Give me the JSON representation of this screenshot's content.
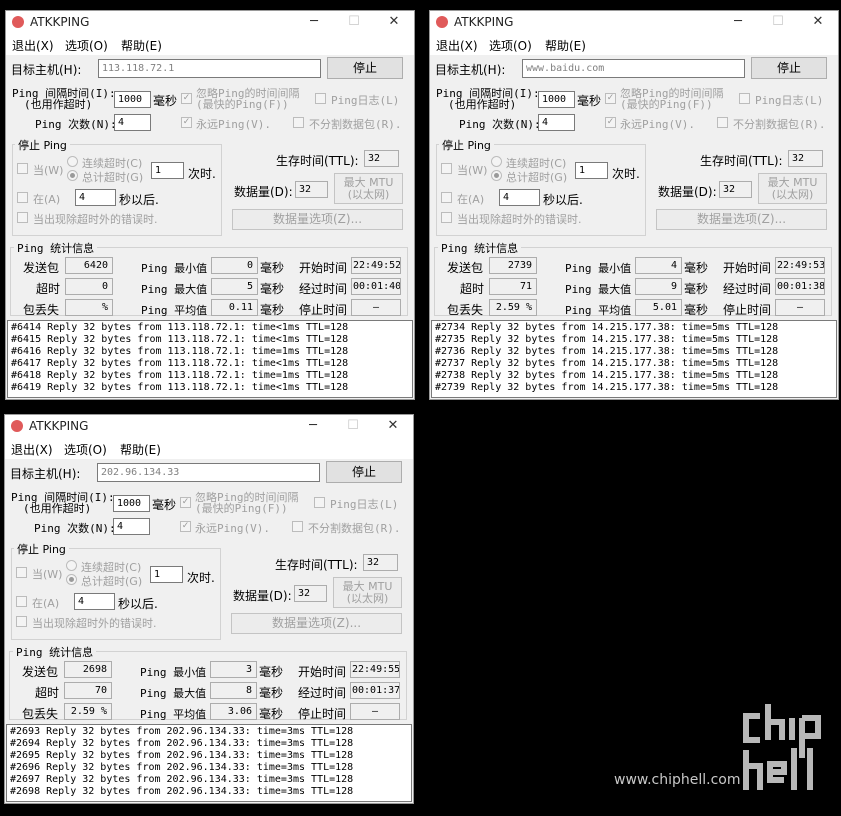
{
  "common": {
    "app_title": "ATKKPING",
    "menu": [
      "退出(X)",
      "选项(O)",
      "帮助(E)"
    ],
    "target_label": "目标主机(H):",
    "stop_button": "停止",
    "interval_label_1": "Ping 间隔时间(I):",
    "interval_label_2": "(也用作超时)",
    "interval_value": "1000",
    "ms": "毫秒",
    "ignore_interval_1": "忽略Ping的时间间隔",
    "ignore_interval_2": "(最快的Ping(F))",
    "ping_log": "Ping日志(L)",
    "count_label": "Ping 次数(N):",
    "count_value": "4",
    "forever": "永远Ping(V).",
    "no_fragment": "不分割数据包(R).",
    "stop_group": "停止 Ping",
    "when": "当(W)",
    "consecutive_timeout": "连续超时(C)",
    "total_timeout": "总计超时(G)",
    "timeout_count": "1",
    "times": "次时.",
    "at": "在(A)",
    "at_value": "4",
    "seconds_later": "秒以后.",
    "on_error": "当出现除超时外的错误时.",
    "ttl_label": "生存时间(TTL):",
    "ttl_value": "32",
    "data_size_label": "数据量(D):",
    "data_size_value": "32",
    "max_mtu_1": "最大 MTU",
    "max_mtu_2": "(以太网)",
    "data_options": "数据量选项(Z)...",
    "stats_group": "Ping  统计信息",
    "sent": "发送包",
    "timeout": "超时",
    "loss": "包丢失",
    "min": "Ping 最小值",
    "max": "Ping 最大值",
    "avg": "Ping 平均值",
    "start_time": "开始时间",
    "elapsed": "经过时间",
    "stop_time": "停止时间",
    "percent": "%"
  },
  "windows": [
    {
      "target": "113.118.72.1",
      "sent": "6420",
      "timeout": "0",
      "loss": "",
      "min": "0",
      "max": "5",
      "avg": "0.11",
      "start_time": "22:49:52",
      "elapsed": "00:01:40",
      "stop_time": "—",
      "log": [
        "#6414 Reply 32 bytes from 113.118.72.1: time<1ms TTL=128",
        "#6415 Reply 32 bytes from 113.118.72.1: time<1ms TTL=128",
        "#6416 Reply 32 bytes from 113.118.72.1: time=1ms TTL=128",
        "#6417 Reply 32 bytes from 113.118.72.1: time<1ms TTL=128",
        "#6418 Reply 32 bytes from 113.118.72.1: time=1ms TTL=128",
        "#6419 Reply 32 bytes from 113.118.72.1: time<1ms TTL=128"
      ]
    },
    {
      "target": "www.baidu.com",
      "sent": "2739",
      "timeout": "71",
      "loss": "2.59",
      "min": "4",
      "max": "9",
      "avg": "5.01",
      "start_time": "22:49:53",
      "elapsed": "00:01:38",
      "stop_time": "—",
      "log": [
        "#2734 Reply 32 bytes from 14.215.177.38: time=5ms TTL=128",
        "#2735 Reply 32 bytes from 14.215.177.38: time=5ms TTL=128",
        "#2736 Reply 32 bytes from 14.215.177.38: time=5ms TTL=128",
        "#2737 Reply 32 bytes from 14.215.177.38: time=5ms TTL=128",
        "#2738 Reply 32 bytes from 14.215.177.38: time=5ms TTL=128",
        "#2739 Reply 32 bytes from 14.215.177.38: time=5ms TTL=128"
      ]
    },
    {
      "target": "202.96.134.33",
      "sent": "2698",
      "timeout": "70",
      "loss": "2.59",
      "min": "3",
      "max": "8",
      "avg": "3.06",
      "start_time": "22:49:55",
      "elapsed": "00:01:37",
      "stop_time": "—",
      "log": [
        "#2693 Reply 32 bytes from 202.96.134.33: time=3ms TTL=128",
        "#2694 Reply 32 bytes from 202.96.134.33: time=3ms TTL=128",
        "#2695 Reply 32 bytes from 202.96.134.33: time=3ms TTL=128",
        "#2696 Reply 32 bytes from 202.96.134.33: time=3ms TTL=128",
        "#2697 Reply 32 bytes from 202.96.134.33: time=3ms TTL=128",
        "#2698 Reply 32 bytes from 202.96.134.33: time=3ms TTL=128"
      ]
    }
  ],
  "watermark": {
    "site": "www.chiphell.com",
    "logo_text": "chip hell"
  }
}
